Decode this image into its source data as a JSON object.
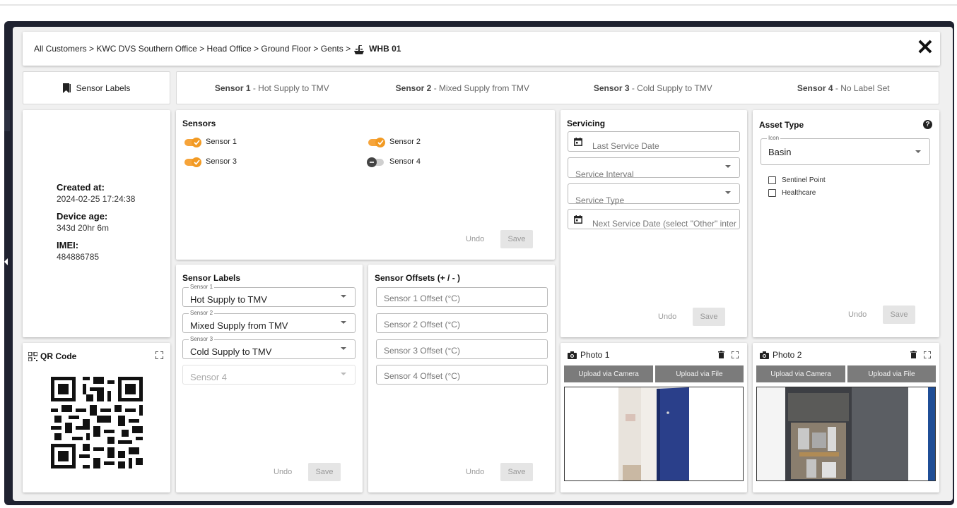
{
  "breadcrumb": {
    "path": "All Customers > KWC DVS Southern Office > Head Office > Ground Floor > Gents >",
    "device": "WHB 01"
  },
  "sensor_labels_tab": "Sensor Labels",
  "sensor_tabs": [
    {
      "name": "Sensor 1",
      "desc": " - Hot Supply to TMV"
    },
    {
      "name": "Sensor 2",
      "desc": " - Mixed Supply from TMV"
    },
    {
      "name": "Sensor 3",
      "desc": " - Cold Supply to TMV"
    },
    {
      "name": "Sensor 4",
      "desc": " - No Label Set"
    }
  ],
  "info": {
    "created_label": "Created at:",
    "created_value": "2024-02-25 17:24:38",
    "age_label": "Device age:",
    "age_value": "343d 20hr 6m",
    "imei_label": "IMEI:",
    "imei_value": "484886785"
  },
  "qr": {
    "title": "QR Code"
  },
  "sensors_panel": {
    "title": "Sensors",
    "toggles": [
      {
        "label": "Sensor 1",
        "on": true
      },
      {
        "label": "Sensor 2",
        "on": true
      },
      {
        "label": "Sensor 3",
        "on": true
      },
      {
        "label": "Sensor 4",
        "on": false
      }
    ],
    "undo": "Undo",
    "save": "Save"
  },
  "labels_panel": {
    "title": "Sensor Labels",
    "fields": [
      {
        "legend": "Sensor 1",
        "value": "Hot Supply to TMV"
      },
      {
        "legend": "Sensor 2",
        "value": "Mixed Supply from TMV"
      },
      {
        "legend": "Sensor 3",
        "value": "Cold Supply to TMV"
      },
      {
        "legend": "",
        "value": "Sensor 4"
      }
    ],
    "undo": "Undo",
    "save": "Save"
  },
  "offsets_panel": {
    "title": "Sensor Offsets (+ / - )",
    "fields": [
      "Sensor 1 Offset (°C)",
      "Sensor 2 Offset (°C)",
      "Sensor 3 Offset (°C)",
      "Sensor 4 Offset (°C)"
    ],
    "undo": "Undo",
    "save": "Save"
  },
  "servicing": {
    "title": "Servicing",
    "last_service": "Last Service Date",
    "interval": "Service Interval",
    "type": "Service Type",
    "next_service": "Next Service Date (select \"Other\" inter",
    "undo": "Undo",
    "save": "Save"
  },
  "asset": {
    "title": "Asset Type",
    "icon_legend": "Icon",
    "icon_value": "Basin",
    "checks": [
      "Sentinel Point",
      "Healthcare"
    ],
    "undo": "Undo",
    "save": "Save"
  },
  "photo1": {
    "title": "Photo 1",
    "camera": "Upload via Camera",
    "file": "Upload via File"
  },
  "photo2": {
    "title": "Photo 2",
    "camera": "Upload via Camera",
    "file": "Upload via File"
  }
}
